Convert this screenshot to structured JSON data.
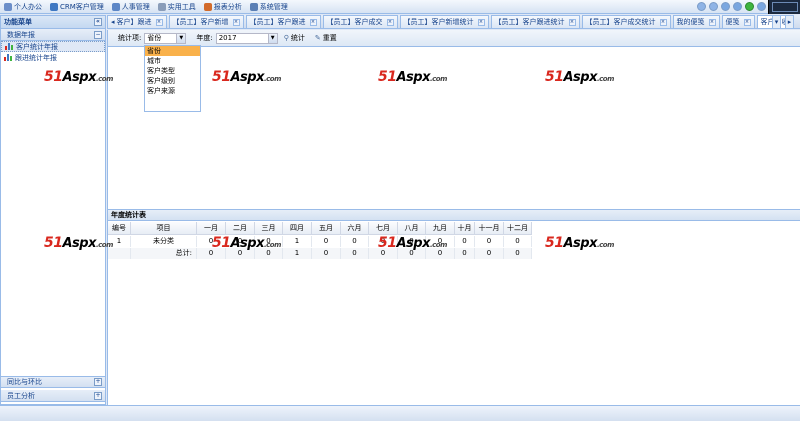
{
  "topmenu": {
    "items": [
      {
        "label": "个人办公",
        "icon": "person-icon",
        "color": "#6b8ec9"
      },
      {
        "label": "CRM客户管理",
        "icon": "crm-icon",
        "color": "#3f78c2"
      },
      {
        "label": "人事管理",
        "icon": "users-icon",
        "color": "#5c86c6"
      },
      {
        "label": "实用工具",
        "icon": "tools-icon",
        "color": "#8a9db9"
      },
      {
        "label": "报表分析",
        "icon": "chart-icon",
        "color": "#d26b2c"
      },
      {
        "label": "系统管理",
        "icon": "gear-icon",
        "color": "#5a7fb5"
      }
    ]
  },
  "sidebar": {
    "title": "功能菜单",
    "section_open": "数据年报",
    "items": [
      {
        "label": "客户统计年报"
      },
      {
        "label": "跟进统计年报"
      }
    ],
    "section_bottom": [
      {
        "label": "同比与环比"
      },
      {
        "label": "员工分析"
      }
    ]
  },
  "tabs": [
    {
      "label": "客户】跟进"
    },
    {
      "label": "【员工】客户新增"
    },
    {
      "label": "【员工】客户跟进"
    },
    {
      "label": "【员工】客户成交"
    },
    {
      "label": "【员工】客户新增统计"
    },
    {
      "label": "【员工】客户跟进统计"
    },
    {
      "label": "【员工】客户成交统计"
    },
    {
      "label": "我的便笺"
    },
    {
      "label": "便笺"
    },
    {
      "label": "客户回收"
    }
  ],
  "toolbar": {
    "stat_label": "统计项:",
    "stat_value": "省份",
    "year_label": "年度:",
    "year_value": "2017",
    "stat_button": "统计",
    "reset_button": "重置"
  },
  "dropdown": {
    "options": [
      "省份",
      "城市",
      "客户类型",
      "客户级别",
      "客户来源"
    ],
    "selected": 0
  },
  "stats": {
    "title": "年度统计表",
    "columns": [
      "编号",
      "项目",
      "一月",
      "二月",
      "三月",
      "四月",
      "五月",
      "六月",
      "七月",
      "八月",
      "九月",
      "十月",
      "十一月",
      "十二月"
    ],
    "rows": [
      [
        "1",
        "未分类",
        "0",
        "0",
        "0",
        "1",
        "0",
        "0",
        "0",
        "0",
        "0",
        "0",
        "0",
        "0"
      ]
    ],
    "summary": [
      "",
      "总计:",
      "0",
      "0",
      "0",
      "1",
      "0",
      "0",
      "0",
      "0",
      "0",
      "0",
      "0",
      "0"
    ]
  },
  "watermark": {
    "a": "51",
    "b": "Aspx",
    "c": ".com"
  },
  "colors": {
    "accent": "#15428b",
    "border": "#99bbe8",
    "selected": "#f9b14b",
    "watermark_red": "#d9281e"
  }
}
